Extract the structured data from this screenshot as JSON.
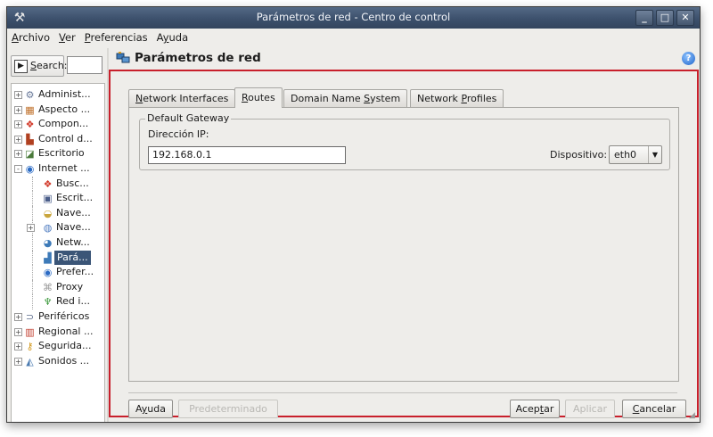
{
  "window": {
    "title": "Parámetros de red - Centro de control",
    "buttons": [
      "_",
      "□",
      "✕"
    ]
  },
  "menubar": {
    "items": [
      {
        "label": "Archivo",
        "mnemonic": "A",
        "rest": "rchivo"
      },
      {
        "label": "Ver",
        "mnemonic": "V",
        "rest": "er"
      },
      {
        "label": "Preferencias",
        "mnemonic": "P",
        "rest": "referencias"
      },
      {
        "label": "Ayuda",
        "pre": "A",
        "mnemonic": "y",
        "rest": "uda"
      }
    ]
  },
  "sidebar": {
    "search_label_mnemonic": "S",
    "search_label_rest": "earch:",
    "search_value": "",
    "tree": [
      {
        "label": "Administ...",
        "icon": "admin-icon",
        "glyph": "⚙",
        "color": "#6a7a9a",
        "level": 0,
        "expander": "+"
      },
      {
        "label": "Aspecto ...",
        "icon": "appearance-icon",
        "glyph": "▦",
        "color": "#c0702a",
        "level": 0,
        "expander": "+"
      },
      {
        "label": "Compon...",
        "icon": "components-icon",
        "glyph": "❖",
        "color": "#d23b2b",
        "level": 0,
        "expander": "+"
      },
      {
        "label": "Control d...",
        "icon": "control-icon",
        "glyph": "▙",
        "color": "#b04020",
        "level": 0,
        "expander": "+"
      },
      {
        "label": "Escritorio",
        "icon": "desktop-icon",
        "glyph": "◪",
        "color": "#4a7a3a",
        "level": 0,
        "expander": "+"
      },
      {
        "label": "Internet ...",
        "icon": "internet-icon",
        "glyph": "◉",
        "color": "#2b6bc4",
        "level": 0,
        "expander": "-"
      },
      {
        "label": "Busc...",
        "icon": "web-search-icon",
        "glyph": "❖",
        "color": "#d23b2b",
        "level": 1
      },
      {
        "label": "Escrit...",
        "icon": "shared-desktop-icon",
        "glyph": "▣",
        "color": "#4b5e8a",
        "level": 1
      },
      {
        "label": "Nave...",
        "icon": "browser-cache-icon",
        "glyph": "◒",
        "color": "#c9a53c",
        "level": 1
      },
      {
        "label": "Nave...",
        "icon": "browser-icon",
        "glyph": "◍",
        "color": "#4f7cc0",
        "level": 1,
        "expander": "+"
      },
      {
        "label": "Netw...",
        "icon": "network-icon",
        "glyph": "◕",
        "color": "#3d7ab8",
        "level": 1
      },
      {
        "label": "Pará...",
        "icon": "network-settings-icon",
        "glyph": "▟",
        "color": "#3d7ab8",
        "level": 1,
        "selected": true
      },
      {
        "label": "Prefer...",
        "icon": "preferences-icon",
        "glyph": "◉",
        "color": "#2b6bc4",
        "level": 1
      },
      {
        "label": "Proxy",
        "icon": "proxy-icon",
        "glyph": "⌘",
        "color": "#9a9a9a",
        "level": 1
      },
      {
        "label": "Red i...",
        "icon": "local-network-icon",
        "glyph": "♆",
        "color": "#3d9a3d",
        "level": 1
      },
      {
        "label": "Periféricos",
        "icon": "peripherals-icon",
        "glyph": "⊃",
        "color": "#5a6a8a",
        "level": 0,
        "expander": "+"
      },
      {
        "label": "Regional ...",
        "icon": "regional-icon",
        "glyph": "▥",
        "color": "#c03a2a",
        "level": 0,
        "expander": "+"
      },
      {
        "label": "Segurida...",
        "icon": "security-icon",
        "glyph": "⚷",
        "color": "#d49a20",
        "level": 0,
        "expander": "+"
      },
      {
        "label": "Sonidos ...",
        "icon": "sounds-icon",
        "glyph": "◭",
        "color": "#4a7ab0",
        "level": 0,
        "expander": "+"
      }
    ]
  },
  "header": {
    "title": "Parámetros de red",
    "help_glyph": "?"
  },
  "tabs": [
    {
      "pre": "",
      "mnemonic": "N",
      "rest": "etwork Interfaces",
      "active": false
    },
    {
      "pre": "",
      "mnemonic": "R",
      "rest": "outes",
      "active": true
    },
    {
      "pre": "Domain Name ",
      "mnemonic": "S",
      "rest": "ystem",
      "active": false
    },
    {
      "pre": "Network ",
      "mnemonic": "P",
      "rest": "rofiles",
      "active": false
    }
  ],
  "routes": {
    "group_title": "Default Gateway",
    "ip_label": "Dirección IP:",
    "ip_value": "192.168.0.1",
    "device_label": "Dispositivo:",
    "device_value": "eth0"
  },
  "buttons": {
    "help": {
      "pre": "A",
      "mnemonic": "y",
      "rest": "uda"
    },
    "defaults": "Predeterminado",
    "accept": {
      "pre": "Acep",
      "mnemonic": "t",
      "rest": "ar"
    },
    "apply": "Aplicar",
    "cancel": {
      "pre": "",
      "mnemonic": "C",
      "rest": "ancelar"
    }
  }
}
